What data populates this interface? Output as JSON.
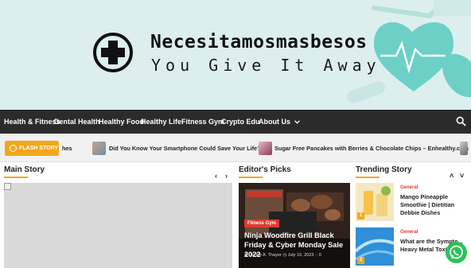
{
  "colors": {
    "accent": "#f2a81d",
    "nav_bg": "#2b2b2b",
    "banner_bg": "#dcefee",
    "category_red": "#e03a2e",
    "whatsapp_green": "#29c35a"
  },
  "header": {
    "site_title": "Necesitamosmasbesos",
    "tagline": "You Give It Away",
    "logo_icon": "medical-cross-icon"
  },
  "nav": {
    "items": [
      "Health & Fitness",
      "Dental Health",
      "Healthy Food",
      "Healthy Life",
      "Fitness Gym",
      "Crypto Edu",
      "About Us"
    ],
    "dropdown_icon": "chevron-down-icon",
    "search_icon": "search-icon"
  },
  "flash": {
    "label": "FLASH STORY",
    "items": [
      {
        "text": "hes"
      },
      {
        "text": "Did You Know Your Smartphone Could Save Your Life?"
      },
      {
        "text": "Sugar Free Pancakes with Berries & Chocolate Chips – Enhealthy.com"
      }
    ]
  },
  "main_story": {
    "title": "Main Story",
    "prev": "‹",
    "next": "›"
  },
  "editors_picks": {
    "title": "Editor's Picks",
    "card": {
      "category": "Fitness Gym",
      "headline": "Ninja Woodfire Grill Black Friday & Cyber Monday Sale 2022",
      "author": "Jackie A. Thayer",
      "date": "July 16, 2023",
      "comments": "0"
    }
  },
  "trending": {
    "title": "Trending Story",
    "up": "˄",
    "down": "˅",
    "items": [
      {
        "num": "1",
        "category": "General",
        "title": "Mango Pineapple Smoothie | Dietitian Debbie Dishes"
      },
      {
        "num": "2",
        "category": "General",
        "title": "What are the Sympto... Heavy Metal Toxicity"
      }
    ]
  }
}
